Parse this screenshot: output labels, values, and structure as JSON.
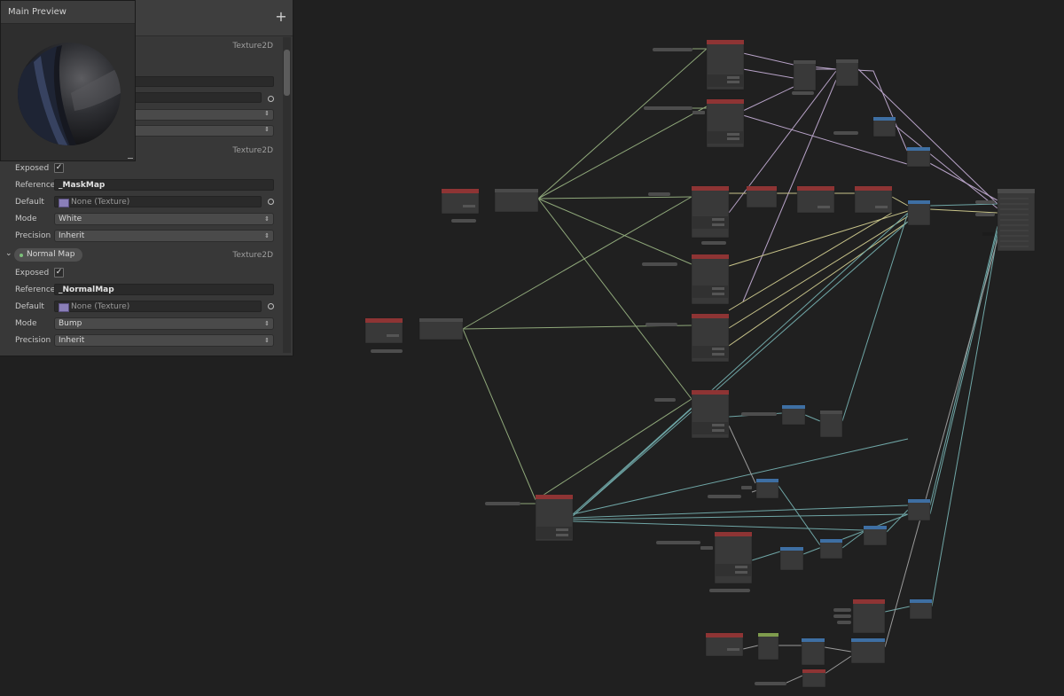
{
  "blackboard": {
    "add_icon": "plus-icon",
    "top_property": {
      "type": "Texture2D"
    },
    "mask_property": {
      "type": "Texture2D",
      "exposed_label": "Exposed",
      "reference_label": "Reference",
      "reference_value": "_MaskMap",
      "default_label": "Default",
      "default_value": "None (Texture)",
      "mode_label": "Mode",
      "mode_value": "White",
      "precision_label": "Precision",
      "precision_value": "Inherit"
    },
    "normal_property": {
      "name": "Normal Map",
      "type": "Texture2D",
      "exposed_label": "Exposed",
      "reference_label": "Reference",
      "reference_value": "_NormalMap",
      "default_label": "Default",
      "default_value": "None (Texture)",
      "mode_label": "Mode",
      "mode_value": "Bump",
      "precision_label": "Precision",
      "precision_value": "Inherit"
    }
  },
  "main_preview": {
    "title": "Main Preview"
  },
  "colors": {
    "canvas": "#202020",
    "panel": "#383838",
    "node_body": "#393939",
    "header_red": "#8e3434",
    "header_blue": "#3e6fa3",
    "header_green": "#7f9c4d",
    "edge_green": "#8fa87a",
    "edge_teal": "#6fa6a6",
    "edge_yellow": "#c8c48a",
    "edge_pink": "#b8a3c8"
  }
}
